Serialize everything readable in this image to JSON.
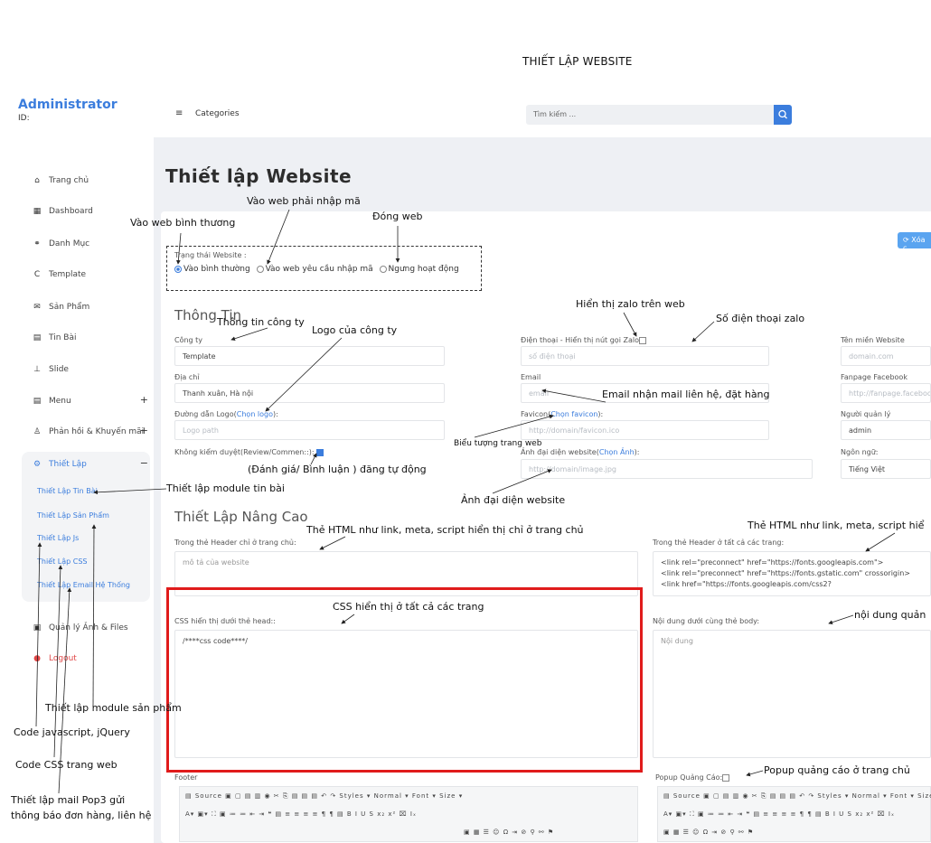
{
  "document_title": "THIẾT LẬP WEBSITE",
  "sidebar": {
    "brand": "Administrator",
    "id_label": "ID:",
    "items": [
      {
        "label": "Trang chủ",
        "icon": "home-icon"
      },
      {
        "label": "Dashboard",
        "icon": "dashboard-icon"
      },
      {
        "label": "Danh Mục",
        "icon": "tag-icon"
      },
      {
        "label": "Template",
        "icon": "template-icon"
      },
      {
        "label": "Sản Phẩm",
        "icon": "product-icon"
      },
      {
        "label": "Tin Bài",
        "icon": "news-icon"
      },
      {
        "label": "Slide",
        "icon": "slide-icon"
      },
      {
        "label": "Menu",
        "icon": "menu-icon",
        "plus": "+"
      },
      {
        "label": "Phản hồi & Khuyến mãi",
        "icon": "feedback-icon",
        "plus": "+"
      },
      {
        "label": "Thiết Lập",
        "icon": "gear-icon",
        "minus": "−"
      }
    ],
    "sub_items": [
      "Thiết Lập Tin Bài",
      "Thiết Lập Sản Phẩm",
      "Thiết Lập Js",
      "Thiết Lập CSS",
      "Thiết Lập Email Hệ Thống"
    ],
    "bottom_items": [
      {
        "label": "Quản lý Ảnh & Files",
        "icon": "files-icon"
      },
      {
        "label": "Logout",
        "icon": "logout-icon"
      }
    ]
  },
  "topbar": {
    "menu_icon": "≡",
    "categories": "Categories",
    "search_placeholder": "Tìm kiếm ..."
  },
  "page_title": "Thiết lập Website",
  "xoa_button": "Xóa c",
  "status": {
    "label": "Trạng thái Website :",
    "options": [
      "Vào bình thường",
      "Vào web yêu cầu nhập mã",
      "Ngưng hoạt động"
    ],
    "selected": 0
  },
  "info_section": {
    "title": "Thông Tin",
    "company_label": "Công ty",
    "company_value": "Template",
    "address_label": "Địa chỉ",
    "address_value": "Thanh xuân, Hà nội",
    "logo_label_a": "Đường dẫn Logo(",
    "logo_link": "Chọn logo",
    "logo_label_b": "):",
    "logo_placeholder": "Logo path",
    "review_label": "Không kiểm duyệt(Review/Commen::):",
    "phone_label": "Điện thoại - Hiển thị nút gọi Zalo",
    "phone_placeholder": "số điện thoại",
    "email_label": "Email",
    "email_placeholder": "email",
    "favicon_label_a": "Favicon(",
    "favicon_link": "Chọn favicon",
    "favicon_label_b": "):",
    "favicon_placeholder": "http://domain/favicon.ico",
    "image_label_a": "Ảnh đại diện website(",
    "image_link": "Chọn Ảnh",
    "image_label_b": "):",
    "image_placeholder": "http://domain/image.jpg",
    "domain_label": "Tên miền Website",
    "domain_placeholder": "domain.com",
    "fanpage_label": "Fanpage Facebook",
    "fanpage_placeholder": "http://fanpage.faceboo",
    "manager_label": "Người quản lý",
    "manager_value": "admin",
    "language_label": "Ngôn ngữ:",
    "language_value": "Tiếng Việt"
  },
  "advanced_section": {
    "title": "Thiết Lập Nâng Cao",
    "header_home_label": "Trong thẻ Header chỉ ở trang chủ:",
    "header_home_placeholder": "mô tả của website",
    "header_all_label": "Trong thẻ Header ở tất cả các trang:",
    "header_all_lines": [
      "<link rel=\"preconnect\" href=\"https://fonts.googleapis.com\">",
      "<link rel=\"preconnect\" href=\"https://fonts.gstatic.com\" crossorigin>",
      "<link href=\"https://fonts.googleapis.com/css2?"
    ],
    "css_label": "CSS hiển thị dưới thẻ head::",
    "css_value": "/****css code****/",
    "body_bottom_label": "Nội dung dưới cùng thẻ body:",
    "body_bottom_placeholder": "Nội dung",
    "footer_label": "Footer",
    "popup_label": "Popup Quảng Cáo:",
    "toolbar_row1": "▤ Source  ▣ ▢ ▤ ▥ ◉  ✂ ⎘ ▤ ▤ ▤  ↶ ↷   Styles  ▾  Normal  ▾  Font  ▾  Size  ▾",
    "toolbar_row2": "A▾ ▣▾ ⛶ ▣  ≔ ≔ ⇤ ⇥ ❝ ▤  ≡ ≡ ≡ ≡  ¶ ¶ ▤  B I U S x₂ x²  ⌧ Iₓ",
    "toolbar_row3": "▣ ▦ ☰ ☺ Ω ⇥ ⊘  ⚲ ⚯  ⚑"
  },
  "annotations": {
    "normal": "Vào web bình thương",
    "code_required": "Vào web phải nhập mã",
    "closed": "Đóng web",
    "company_info": "Thông tin công ty",
    "company_logo": "Logo của công ty",
    "show_zalo": "Hiển thị zalo trên web",
    "zalo_phone": "Số điện thoại zalo",
    "email_contact": "Email nhận mail liên hệ, đặt hàng",
    "favicon": "Biểu tượng trang web",
    "auto_post": "(Đánh giá/ Bình luận ) đăng tự động",
    "website_image": "Ảnh đại diện website",
    "news_module": "Thiết lập module tin bài",
    "html_home": "Thẻ HTML như link, meta, script hiển thị chỉ ở trang chủ",
    "html_all": "Thẻ HTML như link, meta, script hiể",
    "css_all": "CSS hiển thị ở tất cả các trang",
    "body_content": "nội dung quản",
    "product_module": "Thiết lập module sản phẩm",
    "js_code": "Code javascript, jQuery",
    "css_code": "Code CSS trang web",
    "mail_line1": "Thiết lập mail Pop3 gửi",
    "mail_line2": "thông báo đơn hàng, liên hệ",
    "popup_home": "Popup quảng cáo ở trang chủ"
  },
  "colors": {
    "accent": "#3b7ddd",
    "highlight_box": "#e01b1b",
    "background": "#eef0f4"
  }
}
